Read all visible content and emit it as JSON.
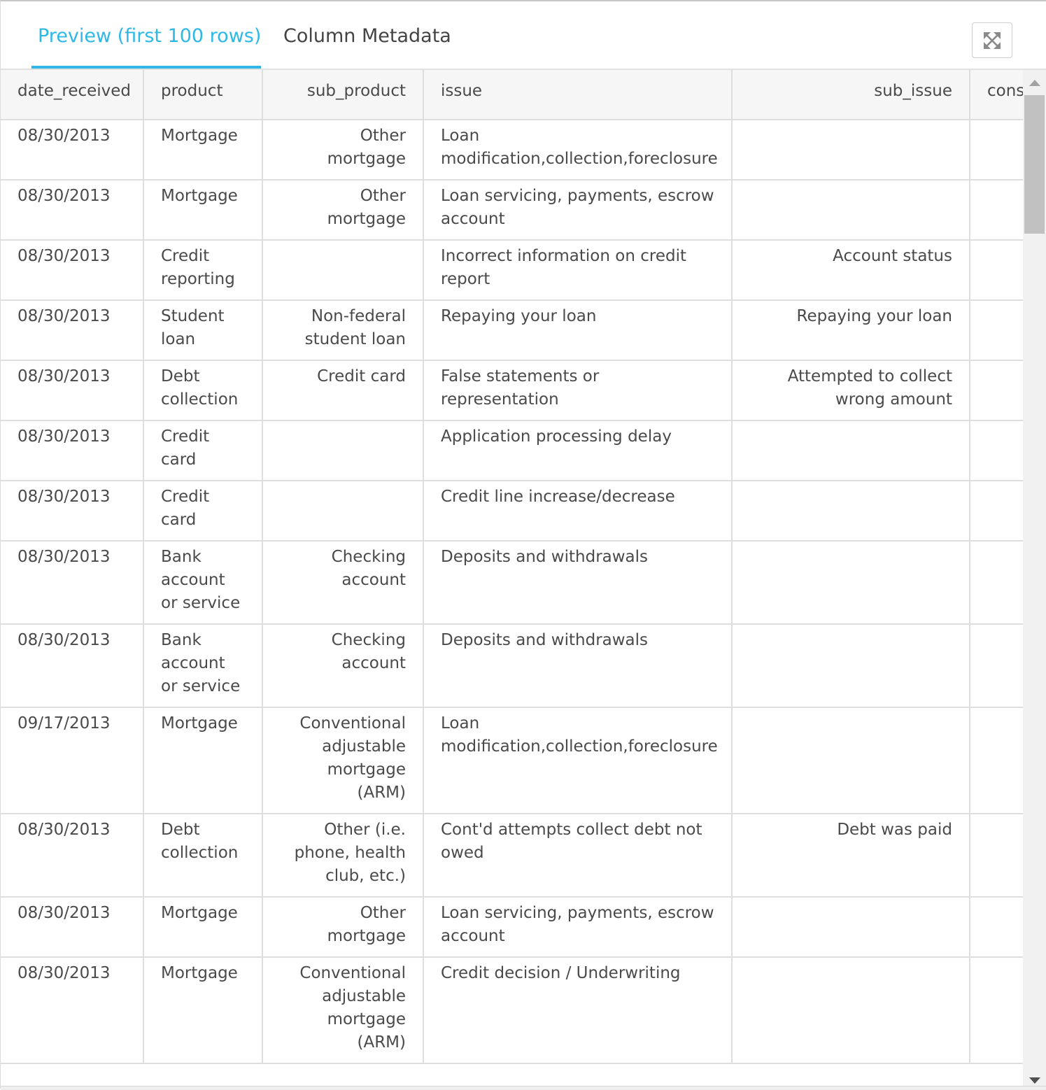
{
  "tabs": [
    {
      "label": "Preview (first 100 rows)",
      "active": true
    },
    {
      "label": "Column Metadata",
      "active": false
    }
  ],
  "toolbar": {
    "expand_icon": "expand-arrows-icon"
  },
  "colors": {
    "accent": "#2fb8e6",
    "border": "#dedede",
    "header_bg": "#f6f6f6",
    "text": "#4a4a4a"
  },
  "table": {
    "columns": [
      "date_received",
      "product",
      "sub_product",
      "issue",
      "sub_issue",
      "consumer_complaint_narrative"
    ],
    "rows": [
      [
        "08/30/2013",
        "Mortgage",
        "Other mortgage",
        "Loan modification,collection,foreclosure",
        "",
        ""
      ],
      [
        "08/30/2013",
        "Mortgage",
        "Other mortgage",
        "Loan servicing, payments, escrow account",
        "",
        ""
      ],
      [
        "08/30/2013",
        "Credit reporting",
        "",
        "Incorrect information on credit report",
        "Account status",
        ""
      ],
      [
        "08/30/2013",
        "Student loan",
        "Non-federal student loan",
        "Repaying your loan",
        "Repaying your loan",
        ""
      ],
      [
        "08/30/2013",
        "Debt collection",
        "Credit card",
        "False statements or representation",
        "Attempted to collect wrong amount",
        ""
      ],
      [
        "08/30/2013",
        "Credit card",
        "",
        "Application processing delay",
        "",
        ""
      ],
      [
        "08/30/2013",
        "Credit card",
        "",
        "Credit line increase/decrease",
        "",
        ""
      ],
      [
        "08/30/2013",
        "Bank account or service",
        "Checking account",
        "Deposits and withdrawals",
        "",
        ""
      ],
      [
        "08/30/2013",
        "Bank account or service",
        "Checking account",
        "Deposits and withdrawals",
        "",
        ""
      ],
      [
        "09/17/2013",
        "Mortgage",
        "Conventional adjustable mortgage (ARM)",
        "Loan modification,collection,foreclosure",
        "",
        ""
      ],
      [
        "08/30/2013",
        "Debt collection",
        "Other (i.e. phone, health club, etc.)",
        "Cont'd attempts collect debt not owed",
        "Debt was paid",
        ""
      ],
      [
        "08/30/2013",
        "Mortgage",
        "Other mortgage",
        "Loan servicing, payments, escrow account",
        "",
        ""
      ],
      [
        "08/30/2013",
        "Mortgage",
        "Conventional adjustable mortgage (ARM)",
        "Credit decision / Underwriting",
        "",
        ""
      ]
    ]
  }
}
